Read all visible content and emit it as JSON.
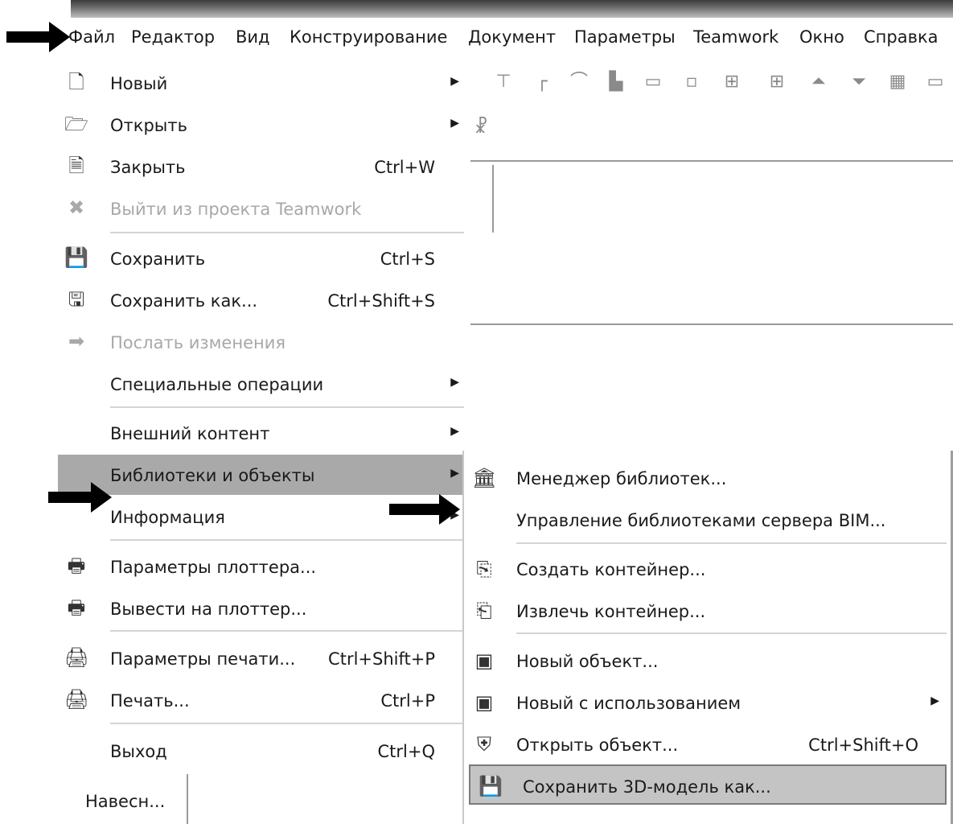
{
  "menubar": {
    "items": [
      "Файл",
      "Редактор",
      "Вид",
      "Конструирование",
      "Документ",
      "Параметры",
      "Teamwork",
      "Окно",
      "Справка"
    ]
  },
  "file_menu": {
    "items": [
      {
        "label": "Новый",
        "shortcut": "",
        "submenu": true,
        "icon": "new-document-icon"
      },
      {
        "label": "Открыть",
        "shortcut": "",
        "submenu": true,
        "icon": "open-folder-icon"
      },
      {
        "label": "Закрыть",
        "shortcut": "Ctrl+W",
        "submenu": false,
        "icon": "close-document-icon"
      },
      {
        "label": "Выйти из проекта Teamwork",
        "shortcut": "",
        "submenu": false,
        "icon": "teamwork-leave-icon",
        "disabled": true
      },
      {
        "label": "Сохранить",
        "shortcut": "Ctrl+S",
        "submenu": false,
        "icon": "floppy-disk-icon"
      },
      {
        "label": "Сохранить как...",
        "shortcut": "Ctrl+Shift+S",
        "submenu": false,
        "icon": "save-as-icon"
      },
      {
        "label": "Послать изменения",
        "shortcut": "",
        "submenu": false,
        "icon": "send-arrow-icon",
        "disabled": true
      },
      {
        "label": "Специальные операции",
        "shortcut": "",
        "submenu": true,
        "icon": ""
      },
      {
        "label": "Внешний контент",
        "shortcut": "",
        "submenu": true,
        "icon": ""
      },
      {
        "label": "Библиотеки и объекты",
        "shortcut": "",
        "submenu": true,
        "icon": "",
        "highlighted": true
      },
      {
        "label": "Информация",
        "shortcut": "",
        "submenu": true,
        "icon": ""
      },
      {
        "label": "Параметры плоттера...",
        "shortcut": "",
        "submenu": false,
        "icon": "plotter-settings-icon"
      },
      {
        "label": "Вывести на плоттер...",
        "shortcut": "",
        "submenu": false,
        "icon": "plotter-icon"
      },
      {
        "label": "Параметры печати...",
        "shortcut": "Ctrl+Shift+P",
        "submenu": false,
        "icon": "print-settings-icon"
      },
      {
        "label": "Печать...",
        "shortcut": "Ctrl+P",
        "submenu": false,
        "icon": "printer-icon"
      },
      {
        "label": "Выход",
        "shortcut": "Ctrl+Q",
        "submenu": false,
        "icon": ""
      }
    ]
  },
  "library_submenu": {
    "items": [
      {
        "label": "Менеджер библиотек...",
        "shortcut": "",
        "icon": "library-manager-icon"
      },
      {
        "label": "Управление библиотеками сервера BIM...",
        "shortcut": "",
        "icon": ""
      },
      {
        "label": "Создать контейнер...",
        "shortcut": "",
        "icon": "create-container-icon"
      },
      {
        "label": "Извлечь контейнер...",
        "shortcut": "",
        "icon": "extract-container-icon"
      },
      {
        "label": "Новый объект...",
        "shortcut": "",
        "icon": "new-object-icon"
      },
      {
        "label": "Новый с использованием",
        "shortcut": "",
        "icon": "new-object-using-icon",
        "submenu": true
      },
      {
        "label": "Открыть объект...",
        "shortcut": "Ctrl+Shift+O",
        "icon": "open-object-icon"
      },
      {
        "label": "Сохранить 3D-модель как...",
        "shortcut": "",
        "icon": "save-3d-model-icon",
        "highlighted": true
      }
    ]
  },
  "bottom_tab": {
    "label": "Навесн..."
  },
  "colors": {
    "highlight": "#a9a9a9",
    "submenu_highlight": "#c4c4c4",
    "disabled": "#a8a8a8"
  }
}
